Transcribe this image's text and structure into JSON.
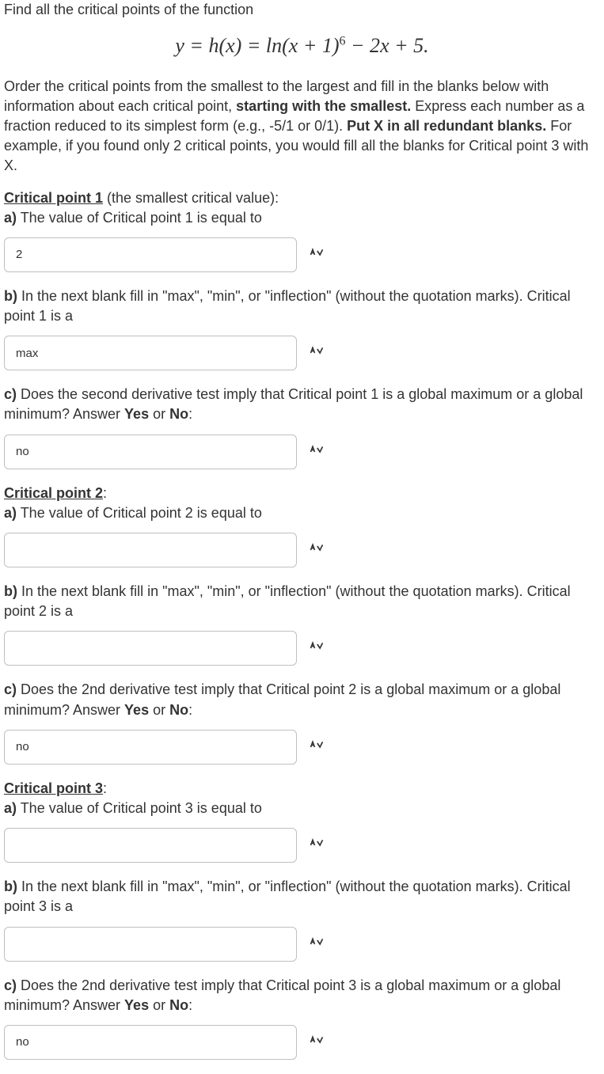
{
  "intro": "Find all the critical points of the function",
  "equation_html": "y = h(x) = ln(x + 1)⁶ − 2x + 5.",
  "instructions_parts": {
    "p1": "Order the critical points from the smallest to the largest and fill in the blanks below with information about each critical point, ",
    "b1": "starting with the smallest.",
    "p2": " Express each number as a fraction reduced to its simplest form (e.g., -5/1 or 0/1). ",
    "b2": "Put X in all redundant blanks.",
    "p3": " For example, if you found only 2 critical points, you would fill all the blanks for Critical point 3 with X."
  },
  "cp1": {
    "heading": "Critical point 1",
    "heading_suffix": " (the smallest critical value):",
    "a_label": "a)",
    "a_text": " The value of Critical point 1 is equal to",
    "a_value": "2",
    "b_label": "b)",
    "b_text": " In the next blank fill in \"max\", \"min\", or \"inflection\" (without the quotation marks). Critical point 1 is a",
    "b_value": "max",
    "c_label": "c)",
    "c_text_1": " Does the second derivative test imply that Critical point 1 is a global maximum or a global minimum? Answer ",
    "c_yes": "Yes",
    "c_or": " or ",
    "c_no": "No",
    "c_colon": ":",
    "c_value": "no"
  },
  "cp2": {
    "heading": "Critical point 2",
    "heading_suffix": ":",
    "a_label": "a)",
    "a_text": " The value of Critical point 2 is equal to",
    "a_value": "",
    "b_label": "b)",
    "b_text": " In the next blank fill in \"max\", \"min\", or \"inflection\" (without the quotation marks). Critical point 2 is a",
    "b_value": "",
    "c_label": "c)",
    "c_text_1": " Does the 2nd derivative test imply that Critical point 2 is a global maximum or a global minimum? Answer ",
    "c_yes": "Yes",
    "c_or": " or ",
    "c_no": "No",
    "c_colon": ":",
    "c_value": "no"
  },
  "cp3": {
    "heading": "Critical point 3",
    "heading_suffix": ":",
    "a_label": "a)",
    "a_text": " The value of Critical point 3 is equal to",
    "a_value": "",
    "b_label": "b)",
    "b_text": " In the next blank fill in \"max\", \"min\", or \"inflection\" (without the quotation marks). Critical point 3 is a",
    "b_value": "",
    "c_label": "c)",
    "c_text_1": " Does the 2nd derivative test imply that Critical point 3 is a global maximum or a global minimum? Answer ",
    "c_yes": "Yes",
    "c_or": " or ",
    "c_no": "No",
    "c_colon": ":",
    "c_value": "no"
  }
}
